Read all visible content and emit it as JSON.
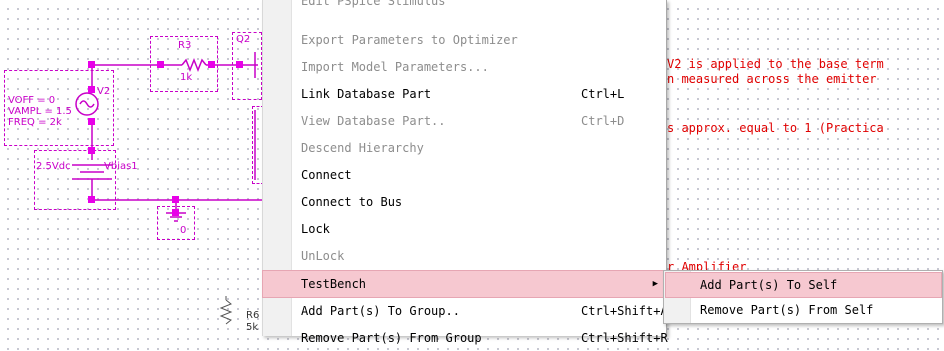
{
  "schematic": {
    "labels": {
      "r3": "R3",
      "r3_value": "1k",
      "q2": "Q2",
      "v2": "V2",
      "voff": "VOFF = 0",
      "vampl": "VAMPL = 1.5",
      "freq": "FREQ = 2k",
      "vbias_value": "2.5Vdc",
      "vbias": "Vbias1",
      "ground": "0",
      "r6": "R6",
      "r6_value": "5k"
    },
    "notes": {
      "line1": "V2 is applied to the base term",
      "line2": "n measured across the emitter",
      "line3": "s approx. equal to 1 (Practica",
      "line4": "r Amplifier"
    }
  },
  "context_menu": {
    "items": [
      {
        "label": "Edit PSpice Stimulus",
        "shortcut": "",
        "disabled": true
      },
      {
        "label": "Export Parameters to Optimizer",
        "shortcut": "",
        "disabled": true
      },
      {
        "label": "Import Model Parameters...",
        "shortcut": "",
        "disabled": true
      },
      {
        "label": "Link Database Part",
        "shortcut": "Ctrl+L",
        "disabled": false
      },
      {
        "label": "View Database Part..",
        "shortcut": "Ctrl+D",
        "disabled": true
      },
      {
        "label": "Descend Hierarchy",
        "shortcut": "",
        "disabled": true
      },
      {
        "label": "Connect",
        "shortcut": "",
        "disabled": false
      },
      {
        "label": "Connect to Bus",
        "shortcut": "",
        "disabled": false
      },
      {
        "label": "Lock",
        "shortcut": "",
        "disabled": false
      },
      {
        "label": "UnLock",
        "shortcut": "",
        "disabled": true
      },
      {
        "label": "TestBench",
        "shortcut": "",
        "disabled": false,
        "submenu": true,
        "highlighted": true
      },
      {
        "label": "Add Part(s) To Group..",
        "shortcut": "Ctrl+Shift+A",
        "disabled": false
      },
      {
        "label": "Remove Part(s) From Group",
        "shortcut": "Ctrl+Shift+R",
        "disabled": false
      }
    ],
    "submenu_arrow": "▶"
  },
  "submenu": {
    "items": [
      {
        "label": "Add Part(s) To Self",
        "highlighted": true
      },
      {
        "label": "Remove Part(s) From Self",
        "highlighted": false
      }
    ]
  },
  "colors": {
    "wire": "#c800c8",
    "note": "#e00000",
    "highlight": "#f6c8d0"
  }
}
